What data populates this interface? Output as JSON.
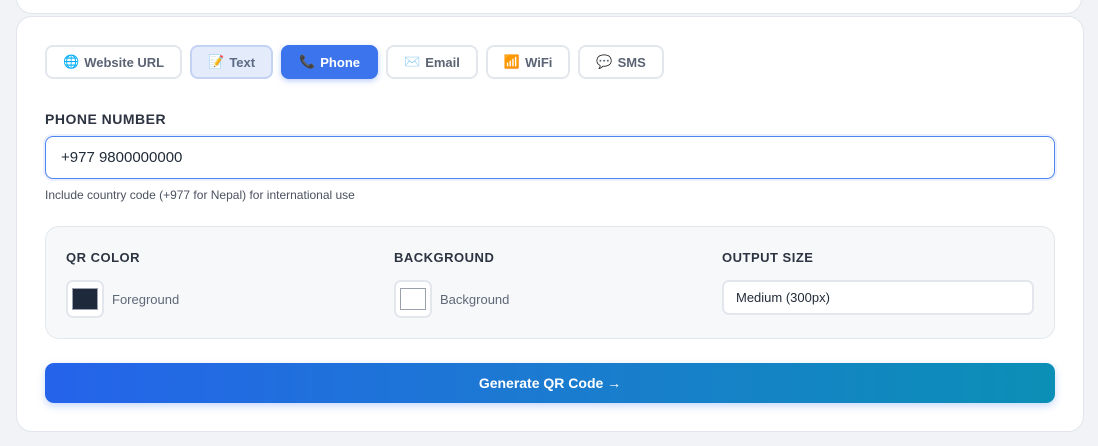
{
  "tabs": [
    {
      "icon": "🌐",
      "icon_name": "globe-icon",
      "label": "Website URL"
    },
    {
      "icon": "📝",
      "icon_name": "memo-icon",
      "label": "Text"
    },
    {
      "icon": "📞",
      "icon_name": "phone-icon",
      "label": "Phone"
    },
    {
      "icon": "✉️",
      "icon_name": "envelope-icon",
      "label": "Email"
    },
    {
      "icon": "📶",
      "icon_name": "signal-icon",
      "label": "WiFi"
    },
    {
      "icon": "💬",
      "icon_name": "speech-bubble-icon",
      "label": "SMS"
    }
  ],
  "active_tab": "Phone",
  "phone": {
    "label": "PHONE NUMBER",
    "value": "+977 9800000000",
    "hint": "Include country code (+977 for Nepal) for international use"
  },
  "options": {
    "qr_color": {
      "label": "QR COLOR",
      "swatch_label": "Foreground",
      "color": "#1e293b"
    },
    "background": {
      "label": "BACKGROUND",
      "swatch_label": "Background",
      "color": "#ffffff"
    },
    "output_size": {
      "label": "OUTPUT SIZE",
      "value": "Medium (300px)"
    }
  },
  "generate_label": "Generate QR Code →",
  "colors": {
    "accent": "#3b74ec",
    "gradient_start": "#2563eb",
    "gradient_end": "#0b8fb6"
  }
}
